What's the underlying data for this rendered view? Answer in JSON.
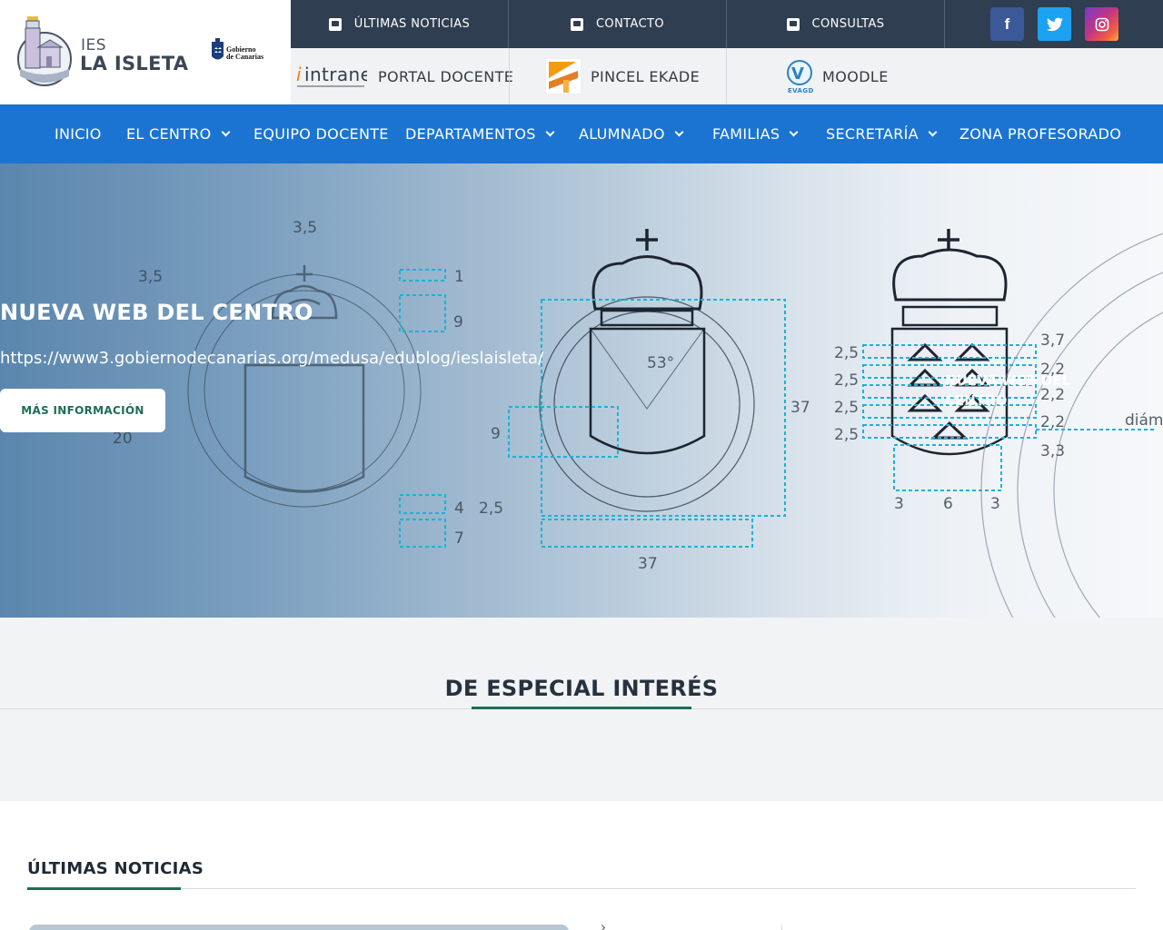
{
  "header": {
    "logo": {
      "ies": "IES",
      "name": "LA ISLETA"
    },
    "gobierno": {
      "line1": "Gobierno",
      "line2": "de Canarias"
    },
    "top_links": [
      {
        "label": "ÚLTIMAS NOTICIAS",
        "icon": "news-icon"
      },
      {
        "label": "CONTACTO",
        "icon": "contact-icon"
      },
      {
        "label": "CONSULTAS",
        "icon": "inbox-icon"
      }
    ],
    "social": {
      "facebook": "f",
      "twitter": "twitter-icon",
      "instagram": "instagram-icon"
    },
    "portals": [
      {
        "logo_text": "intranet",
        "label": "PORTAL DOCENTE"
      },
      {
        "label": "PINCEL EKADE"
      },
      {
        "logo_text": "EVAGD",
        "label": "MOODLE"
      }
    ]
  },
  "nav": {
    "items": [
      {
        "label": "INICIO",
        "dropdown": false
      },
      {
        "label": "EL CENTRO",
        "dropdown": true
      },
      {
        "label": "EQUIPO DOCENTE",
        "dropdown": false
      },
      {
        "label": "DEPARTAMENTOS",
        "dropdown": true
      },
      {
        "label": "ALUMNADO",
        "dropdown": true
      },
      {
        "label": "FAMILIAS",
        "dropdown": true
      },
      {
        "label": "SECRETARÍA",
        "dropdown": true
      },
      {
        "label": "ZONA PROFESORADO",
        "dropdown": false
      }
    ]
  },
  "hero": {
    "title": "NUEVA WEB DEL CENTRO",
    "url": "https://www3.gobiernodecanarias.org/medusa/edublog/ieslaisleta/",
    "button": "MÁS INFORMACIÓN",
    "ghost_text": "NUEVA WEB DEL CENTRO",
    "figures": [
      "3,5",
      "3,5",
      "1",
      "9",
      "20",
      "4",
      "2,5",
      "7",
      "53°",
      "9",
      "37",
      "37",
      "2,5",
      "2,5",
      "2,5",
      "2,5",
      "3,7",
      "2,2",
      "2,2",
      "2,2",
      "3,3",
      "3",
      "6",
      "3",
      "diám"
    ]
  },
  "interes": {
    "title": "DE ESPECIAL INTERÉS"
  },
  "noticias": {
    "title": "ÚLTIMAS NOTICIAS"
  },
  "colors": {
    "nav": "#1b74d2",
    "dark_bar": "#2f3e50",
    "accent_green": "#1d6e55"
  }
}
